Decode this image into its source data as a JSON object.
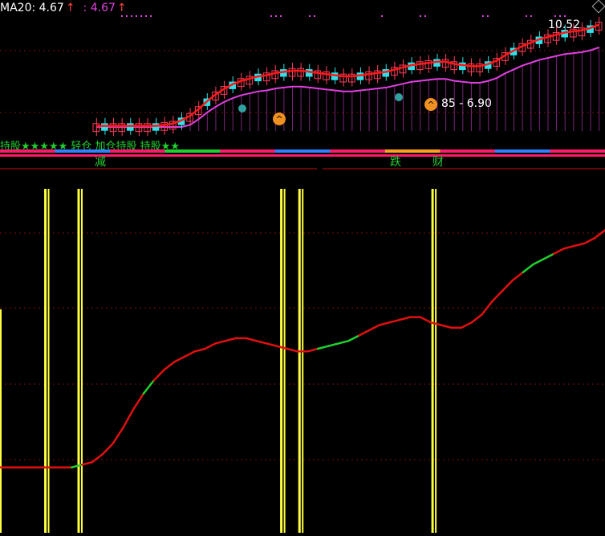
{
  "header": {
    "ma_label": "MA20: 4.67",
    "ma_label_arrow": "↑",
    "ma_value2": ": 4.67",
    "ma_value2_arrow": "↑"
  },
  "price_panel": {
    "high_label": "10.52",
    "range_label": "85 - 6.90",
    "ribbon_text": "持股★★★★★ 轻仓 加仓持股 持股★★"
  },
  "signal_labels": [
    "减",
    "跌",
    "财"
  ],
  "colors": {
    "up_candle": "#ff3c5a",
    "down_candle": "#30e0e8",
    "ma_short": "#ff1a1a",
    "ma_long": "#e040e0",
    "signal_line": "#ffff40",
    "trend_up": "#e01010",
    "trend_flat": "#20d030",
    "grid": "#7a1010"
  },
  "chart_data": {
    "type": "line",
    "trend_series": {
      "name": "",
      "values": [
        0.05,
        0.05,
        0.05,
        0.05,
        0.05,
        0.05,
        0.05,
        0.05,
        0.06,
        0.07,
        0.1,
        0.14,
        0.2,
        0.27,
        0.33,
        0.38,
        0.42,
        0.45,
        0.47,
        0.49,
        0.5,
        0.52,
        0.53,
        0.54,
        0.54,
        0.53,
        0.52,
        0.51,
        0.5,
        0.49,
        0.49,
        0.5,
        0.51,
        0.52,
        0.53,
        0.55,
        0.57,
        0.59,
        0.6,
        0.61,
        0.62,
        0.62,
        0.6,
        0.59,
        0.58,
        0.58,
        0.6,
        0.63,
        0.68,
        0.72,
        0.76,
        0.79,
        0.82,
        0.84,
        0.86,
        0.88,
        0.89,
        0.9,
        0.92,
        0.95
      ],
      "flat_segments": [
        [
          7,
          8
        ],
        [
          14,
          15
        ],
        [
          31,
          35
        ],
        [
          51,
          54
        ]
      ]
    },
    "signal_spikes": [
      0.075,
      0.13,
      0.465,
      0.495,
      0.715
    ],
    "candles": {
      "count": 60
    }
  }
}
